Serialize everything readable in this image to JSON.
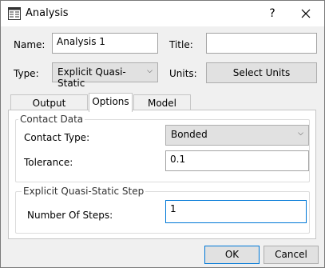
{
  "window": {
    "title": "Analysis",
    "help_glyph": "?",
    "close_glyph": "✕"
  },
  "form": {
    "name_label": "Name:",
    "name_value": "Analysis 1",
    "title_label": "Title:",
    "title_value": "",
    "type_label": "Type:",
    "type_value": "Explicit Quasi-Static",
    "units_label": "Units:",
    "select_units_label": "Select Units"
  },
  "tabs": [
    {
      "label": "Output Controls"
    },
    {
      "label": "Options"
    },
    {
      "label": "Model State"
    }
  ],
  "contact": {
    "group_title": "Contact Data",
    "type_label": "Contact Type:",
    "type_value": "Bonded",
    "tolerance_label": "Tolerance:",
    "tolerance_value": "0.1"
  },
  "step": {
    "group_title": "Explicit Quasi-Static Step",
    "steps_label": "Number Of Steps:",
    "steps_value": "1"
  },
  "footer": {
    "ok_label": "OK",
    "cancel_label": "Cancel"
  },
  "icons": {
    "app": "dialog-grid-icon",
    "dropdown": "chevron-down-icon"
  }
}
